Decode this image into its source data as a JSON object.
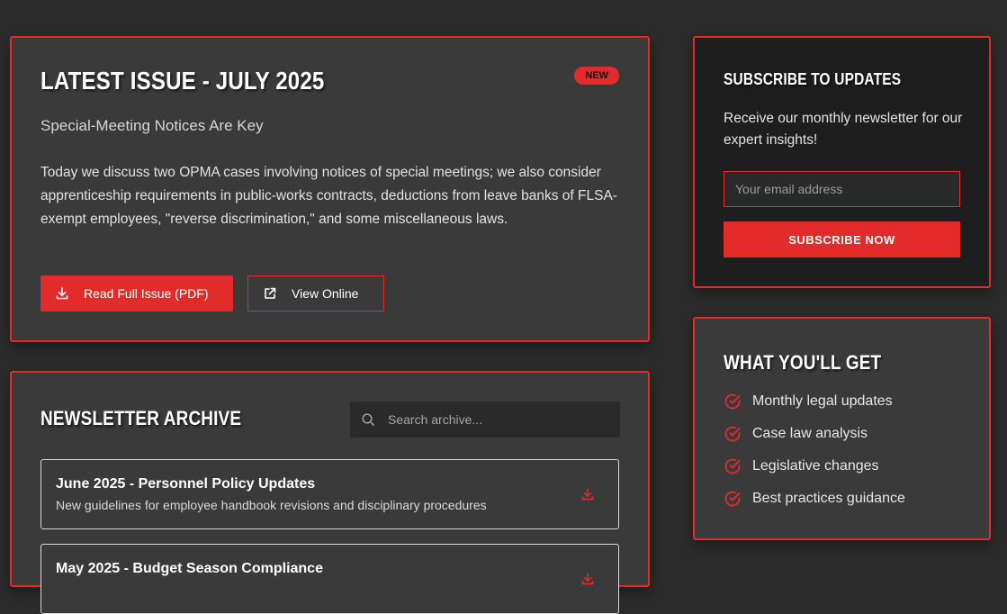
{
  "latest": {
    "heading": "Latest Issue - July 2025",
    "badge": "NEW",
    "subtitle": "Special-Meeting Notices Are Key",
    "description": "Today we discuss two OPMA cases involving notices of special meetings; we also consider apprenticeship requirements in public-works contracts, deductions from leave banks of FLSA-exempt employees, \"reverse discrimination,\" and some miscellaneous laws.",
    "read_button": "Read Full Issue (PDF)",
    "view_button": "View Online"
  },
  "archive": {
    "heading": "Newsletter Archive",
    "search_placeholder": "Search archive...",
    "items": [
      {
        "title": "June 2025 - Personnel Policy Updates",
        "description": "New guidelines for employee handbook revisions and disciplinary procedures"
      },
      {
        "title": "May 2025 - Budget Season Compliance",
        "description": ""
      }
    ]
  },
  "subscribe": {
    "heading": "Subscribe to Updates",
    "text": "Receive our monthly newsletter for our expert insights!",
    "email_placeholder": "Your email address",
    "button": "SUBSCRIBE NOW"
  },
  "benefits": {
    "heading": "What You'll Get",
    "items": [
      {
        "label": "Monthly legal updates"
      },
      {
        "label": "Case law analysis"
      },
      {
        "label": "Legislative changes"
      },
      {
        "label": "Best practices guidance"
      }
    ]
  },
  "colors": {
    "accent": "#e32b2b",
    "background": "#2b2b2b",
    "card": "#3b3a3a"
  }
}
